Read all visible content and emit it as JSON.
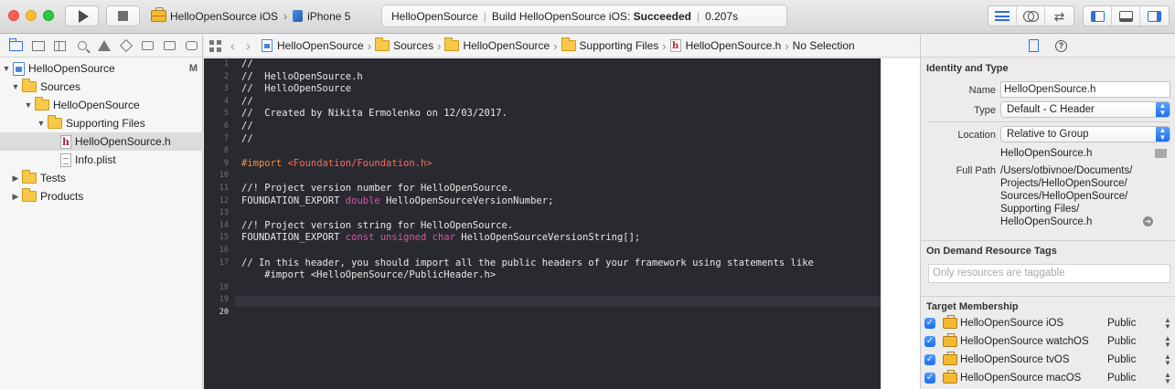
{
  "toolbar": {
    "scheme": "HelloOpenSource iOS",
    "device": "iPhone 5",
    "status_project": "HelloOpenSource",
    "status_build_prefix": "Build HelloOpenSource iOS:",
    "status_result": "Succeeded",
    "status_time": "0.207s"
  },
  "navigator": {
    "items": [
      {
        "label": "HelloOpenSource",
        "badge": "M"
      },
      {
        "label": "Sources"
      },
      {
        "label": "HelloOpenSource"
      },
      {
        "label": "Supporting Files"
      },
      {
        "label": "HelloOpenSource.h"
      },
      {
        "label": "Info.plist"
      },
      {
        "label": "Tests"
      },
      {
        "label": "Products"
      }
    ]
  },
  "jumpbar": {
    "crumbs": [
      "HelloOpenSource",
      "Sources",
      "HelloOpenSource",
      "Supporting Files",
      "HelloOpenSource.h",
      "No Selection"
    ]
  },
  "editor": {
    "line_numbers": [
      "1",
      "2",
      "3",
      "4",
      "5",
      "6",
      "7",
      "8",
      "9",
      "10",
      "11",
      "12",
      "13",
      "14",
      "15",
      "16",
      "17",
      "",
      "18",
      "19",
      "20"
    ],
    "lines": [
      "//",
      "//  HelloOpenSource.h",
      "//  HelloOpenSource",
      "//",
      "//  Created by Nikita Ermolenko on 12/03/2017.",
      "//",
      "//",
      "",
      "#import",
      "<Foundation/Foundation.h>",
      "",
      "//! Project version number for HelloOpenSource.",
      "FOUNDATION_EXPORT",
      "double",
      "HelloOpenSourceVersionNumber;",
      "",
      "//! Project version string for HelloOpenSource.",
      "FOUNDATION_EXPORT",
      "const",
      "unsigned",
      "char",
      "HelloOpenSourceVersionString[];",
      "",
      "// In this header, you should import all the public headers of your framework using statements like",
      "    #import <HelloOpenSource/PublicHeader.h>"
    ]
  },
  "inspector": {
    "identity_title": "Identity and Type",
    "name_label": "Name",
    "name_value": "HelloOpenSource.h",
    "type_label": "Type",
    "type_value": "Default - C Header",
    "location_label": "Location",
    "location_value": "Relative to Group",
    "location_file": "HelloOpenSource.h",
    "fullpath_label": "Full Path",
    "fullpath_lines": [
      "/Users/otbivnoe/Documents/",
      "Projects/HelloOpenSource/",
      "Sources/HelloOpenSource/",
      "Supporting Files/",
      "HelloOpenSource.h"
    ],
    "odr_title": "On Demand Resource Tags",
    "odr_placeholder": "Only resources are taggable",
    "tm_title": "Target Membership",
    "targets": [
      {
        "name": "HelloOpenSource iOS",
        "access": "Public"
      },
      {
        "name": "HelloOpenSource watchOS",
        "access": "Public"
      },
      {
        "name": "HelloOpenSource tvOS",
        "access": "Public"
      },
      {
        "name": "HelloOpenSource macOS",
        "access": "Public"
      }
    ]
  },
  "colors": {
    "editor_bg": "#292a30",
    "comment": "#6bbf59",
    "preprocessor": "#fd8f3f",
    "string": "#fc6a5d",
    "keyword": "#dc53a6",
    "accent": "#2e6fdc"
  }
}
